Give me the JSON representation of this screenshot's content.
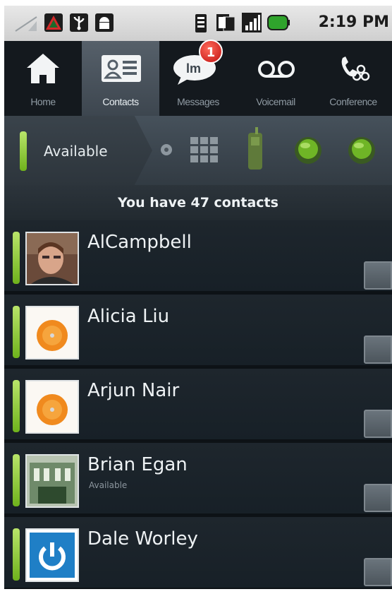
{
  "status_bar": {
    "time": "2:19 PM",
    "icons": [
      "signal-icon",
      "warning-icon",
      "usb-icon",
      "android-icon",
      "vibrate-icon",
      "sim-icon",
      "cell-signal-icon",
      "battery-icon"
    ]
  },
  "tabs": [
    {
      "label": "Home",
      "icon": "home-icon",
      "active": false
    },
    {
      "label": "Contacts",
      "icon": "contacts-card-icon",
      "active": true
    },
    {
      "label": "Messages",
      "icon": "messages-bubble-icon",
      "active": false,
      "badge": "1"
    },
    {
      "label": "Voicemail",
      "icon": "voicemail-icon",
      "active": false
    },
    {
      "label": "Conference",
      "icon": "conference-icon",
      "active": false
    }
  ],
  "presence": {
    "label": "Available",
    "accent": "#8bc34a",
    "icons": [
      "dialpad-icon",
      "phone-icon",
      "status-green-icon",
      "status-green-icon"
    ]
  },
  "banner": {
    "text": "You have 47 contacts"
  },
  "contacts": [
    {
      "name": "AlCampbell",
      "status": "",
      "avatar": "photo-avatar"
    },
    {
      "name": "Alicia Liu",
      "status": "",
      "avatar": "orange-avatar"
    },
    {
      "name": "Arjun Nair",
      "status": "",
      "avatar": "orange-avatar"
    },
    {
      "name": "Brian Egan",
      "status": "Available",
      "avatar": "building-avatar"
    },
    {
      "name": "Dale Worley",
      "status": "",
      "avatar": "power-avatar"
    }
  ]
}
